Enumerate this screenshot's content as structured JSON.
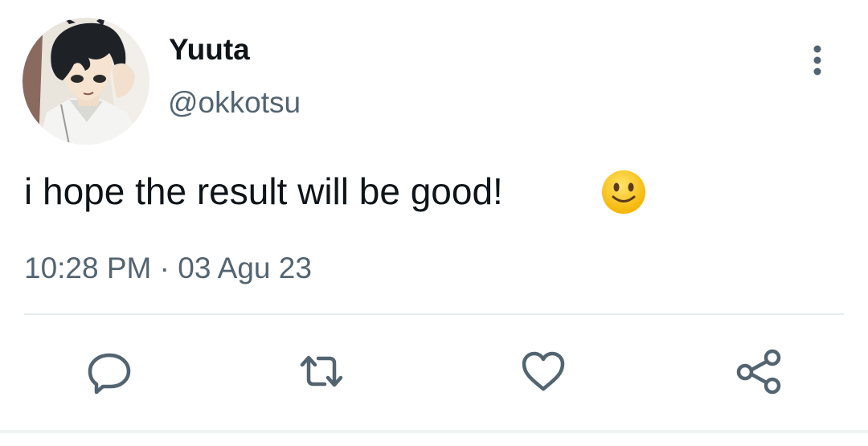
{
  "user": {
    "display_name": "Yuuta",
    "handle": "@okkotsu",
    "avatar_icon": "anime-character-avatar"
  },
  "header": {
    "more_icon": "vertical-ellipsis-icon"
  },
  "tweet": {
    "text": "i hope the result will be good!",
    "emoji": "slightly-smiling-face-emoji",
    "time": "10:28 PM",
    "separator": "·",
    "date": "03 Agu 23"
  },
  "actions": [
    {
      "icon": "reply-icon"
    },
    {
      "icon": "retweet-icon"
    },
    {
      "icon": "like-icon"
    },
    {
      "icon": "share-icon"
    }
  ],
  "colors": {
    "primary_text": "#0f1419",
    "secondary_text": "#536471",
    "icon": "#536471",
    "divider": "#e6ecf0"
  }
}
